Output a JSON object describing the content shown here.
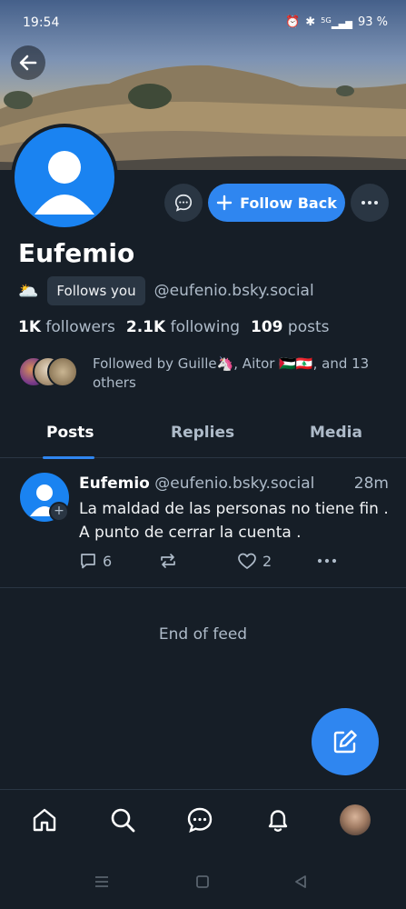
{
  "status_bar": {
    "time": "19:54",
    "battery": "93 %",
    "network": "5G"
  },
  "profile": {
    "display_name": "Eufemio",
    "emoji": "🌥️",
    "follows_you_label": "Follows you",
    "handle": "@eufenio.bsky.social",
    "followers_count": "1K",
    "followers_label": "followers",
    "following_count": "2.1K",
    "following_label": "following",
    "posts_count": "109",
    "posts_label": "posts",
    "followed_by_text": "Followed by Guille🦄, Aitor 🇵🇸🇱🇧, and 13 others"
  },
  "actions": {
    "follow_back_label": "Follow Back"
  },
  "tabs": [
    {
      "label": "Posts",
      "active": true
    },
    {
      "label": "Replies",
      "active": false
    },
    {
      "label": "Media",
      "active": false
    }
  ],
  "post": {
    "author_name": "Eufemio",
    "author_handle": "@eufenio.bsky.social",
    "time": "28m",
    "text": "La maldad de las personas no tiene fin . A punto de cerrar la cuenta .",
    "reply_count": "6",
    "like_count": "2"
  },
  "feed": {
    "end_label": "End of feed"
  },
  "colors": {
    "background": "#161e27",
    "accent": "#2f86f0",
    "avatar_blue": "#1a83f1",
    "muted_text": "#aebbc9"
  }
}
